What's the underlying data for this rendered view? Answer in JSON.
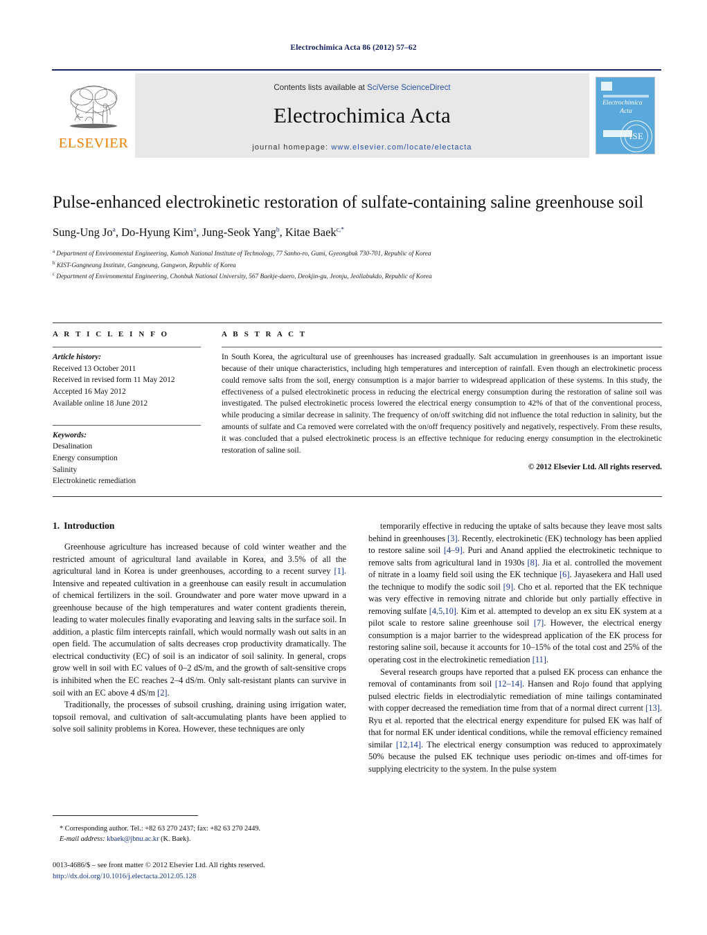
{
  "running_head": "Electrochimica Acta 86 (2012) 57–62",
  "masthead": {
    "publisher_wordmark": "ELSEVIER",
    "contents_prefix": "Contents lists available at ",
    "contents_link": "SciVerse ScienceDirect",
    "journal_name": "Electrochimica Acta",
    "homepage_prefix": "journal homepage: ",
    "homepage_url": "www.elsevier.com/locate/electacta",
    "cover_title_line1": "Electrochimica",
    "cover_title_line2": "Acta",
    "cover_seal_text": "ISE",
    "accent_blue": "#2a52a5",
    "elsevier_orange": "#f08000",
    "cover_blue": "#5aa9dd"
  },
  "article": {
    "title": "Pulse-enhanced electrokinetic restoration of sulfate-containing saline greenhouse soil",
    "authors": [
      {
        "name": "Sung-Ung Jo",
        "marks": "a",
        "sep": ", "
      },
      {
        "name": "Do-Hyung Kim",
        "marks": "a",
        "sep": ", "
      },
      {
        "name": "Jung-Seok Yang",
        "marks": "b",
        "sep": ", "
      },
      {
        "name": "Kitae Baek",
        "marks": "c,*",
        "sep": ""
      }
    ],
    "affiliations": [
      {
        "mark": "a",
        "text": "Department of Environmental Engineering, Kumoh National Institute of Technology, 77 Sanho-ro, Gumi, Gyeongbuk 730-701, Republic of Korea"
      },
      {
        "mark": "b",
        "text": "KIST-Gangneung Institute, Gangneung, Gangwon, Republic of Korea"
      },
      {
        "mark": "c",
        "text": "Department of Environmental Engineering, Chonbuk National University, 567 Baekje-daero, Deokjin-gu, Jeonju, Jeollabukdo, Republic of Korea"
      }
    ]
  },
  "article_info": {
    "heading": "A R T I C L E    I N F O",
    "history_label": "Article history:",
    "history": [
      "Received 13 October 2011",
      "Received in revised form 11 May 2012",
      "Accepted 16 May 2012",
      "Available online 18 June 2012"
    ],
    "keywords_label": "Keywords:",
    "keywords": [
      "Desalination",
      "Energy consumption",
      "Salinity",
      "Electrokinetic remediation"
    ]
  },
  "abstract": {
    "heading": "A B S T R A C T",
    "text": "In South Korea, the agricultural use of greenhouses has increased gradually. Salt accumulation in greenhouses is an important issue because of their unique characteristics, including high temperatures and interception of rainfall. Even though an electrokinetic process could remove salts from the soil, energy consumption is a major barrier to widespread application of these systems. In this study, the effectiveness of a pulsed electrokinetic process in reducing the electrical energy consumption during the restoration of saline soil was investigated. The pulsed electrokinetic process lowered the electrical energy consumption to 42% of that of the conventional process, while producing a similar decrease in salinity. The frequency of on/off switching did not influence the total reduction in salinity, but the amounts of sulfate and Ca removed were correlated with the on/off frequency positively and negatively, respectively. From these results, it was concluded that a pulsed electrokinetic process is an effective technique for reducing energy consumption in the electrokinetic restoration of saline soil.",
    "copyright": "© 2012 Elsevier Ltd. All rights reserved."
  },
  "introduction": {
    "number": "1.",
    "heading": "Introduction",
    "left_paragraphs": [
      "Greenhouse agriculture has increased because of cold winter weather and the restricted amount of agricultural land available in Korea, and 3.5% of all the agricultural land in Korea is under greenhouses, according to a recent survey [1]. Intensive and repeated cultivation in a greenhouse can easily result in accumulation of chemical fertilizers in the soil. Groundwater and pore water move upward in a greenhouse because of the high temperatures and water content gradients therein, leading to water molecules finally evaporating and leaving salts in the surface soil. In addition, a plastic film intercepts rainfall, which would normally wash out salts in an open field. The accumulation of salts decreases crop productivity dramatically. The electrical conductivity (EC) of soil is an indicator of soil salinity. In general, crops grow well in soil with EC values of 0–2 dS/m, and the growth of salt-sensitive crops is inhibited when the EC reaches 2–4 dS/m. Only salt-resistant plants can survive in soil with an EC above 4 dS/m [2].",
      "Traditionally, the processes of subsoil crushing, draining using irrigation water, topsoil removal, and cultivation of salt-accumulating plants have been applied to solve soil salinity problems in Korea. However, these techniques are only"
    ],
    "right_paragraphs": [
      "temporarily effective in reducing the uptake of salts because they leave most salts behind in greenhouses [3]. Recently, electrokinetic (EK) technology has been applied to restore saline soil [4–9]. Puri and Anand applied the electrokinetic technique to remove salts from agricultural land in 1930s [8]. Jia et al. controlled the movement of nitrate in a loamy field soil using the EK technique [6]. Jayasekera and Hall used the technique to modify the sodic soil [9]. Cho et al. reported that the EK technique was very effective in removing nitrate and chloride but only partially effective in removing sulfate [4,5,10]. Kim et al. attempted to develop an ex situ EK system at a pilot scale to restore saline greenhouse soil [7]. However, the electrical energy consumption is a major barrier to the widespread application of the EK process for restoring saline soil, because it accounts for 10–15% of the total cost and 25% of the operating cost in the electrokinetic remediation [11].",
      "Several research groups have reported that a pulsed EK process can enhance the removal of contaminants from soil [12–14]. Hansen and Rojo found that applying pulsed electric fields in electrodialytic remediation of mine tailings contaminated with copper decreased the remediation time from that of a normal direct current [13]. Ryu et al. reported that the electrical energy expenditure for pulsed EK was half of that for normal EK under identical conditions, while the removal efficiency remained similar [12,14]. The electrical energy consumption was reduced to approximately 50% because the pulsed EK technique uses periodic on-times and off-times for supplying electricity to the system. In the pulse system"
    ]
  },
  "footnote": {
    "corresponding": "* Corresponding author. Tel.: +82 63 270 2437; fax: +82 63 270 2449.",
    "email_label": "E-mail address:",
    "email": "kbaek@jbnu.ac.kr",
    "email_suffix": "(K. Baek)."
  },
  "footer": {
    "issn_line": "0013-4686/$ – see front matter © 2012 Elsevier Ltd. All rights reserved.",
    "doi": "http://dx.doi.org/10.1016/j.electacta.2012.05.128"
  }
}
